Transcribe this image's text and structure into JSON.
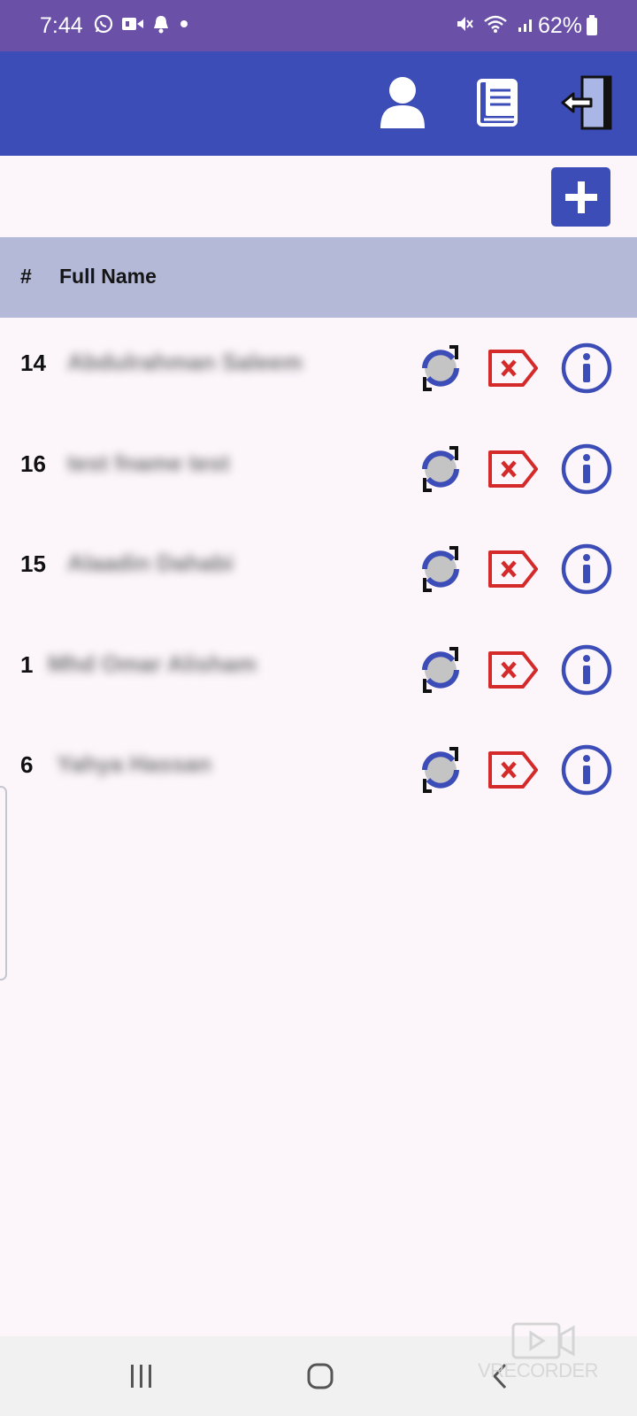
{
  "status_bar": {
    "time": "7:44",
    "battery": "62%",
    "left_icons": [
      "whatsapp-icon",
      "video-icon",
      "notification-bell-icon",
      "dot-icon"
    ],
    "right_icons": [
      "mute-icon",
      "wifi-icon",
      "signal-icon",
      "battery-icon"
    ]
  },
  "app_bar": {
    "actions": [
      "profile-icon",
      "book-icon",
      "logout-icon"
    ],
    "color": "#3d4db7"
  },
  "table": {
    "headers": [
      "#",
      "Full Name"
    ],
    "rows": [
      {
        "id": "14",
        "name": "Abdulrahman Saleem",
        "blurred": true
      },
      {
        "id": "16",
        "name": "test fname test",
        "blurred": true
      },
      {
        "id": "15",
        "name": "Alaadin Dahabi",
        "blurred": true
      },
      {
        "id": "1",
        "name": "Mhd Omar Alisham",
        "blurred": true
      },
      {
        "id": "6",
        "name": "Yahya Hassan",
        "blurred": true
      }
    ],
    "row_actions": [
      "sync-icon",
      "delete-tag-icon",
      "info-icon"
    ]
  },
  "watermark": "VRECORDER",
  "colors": {
    "accent": "#3d4db7",
    "status_bar": "#6a50a7",
    "header_row": "#b4b9d8",
    "delete": "#d42a2a",
    "background": "#fcf6fb"
  }
}
